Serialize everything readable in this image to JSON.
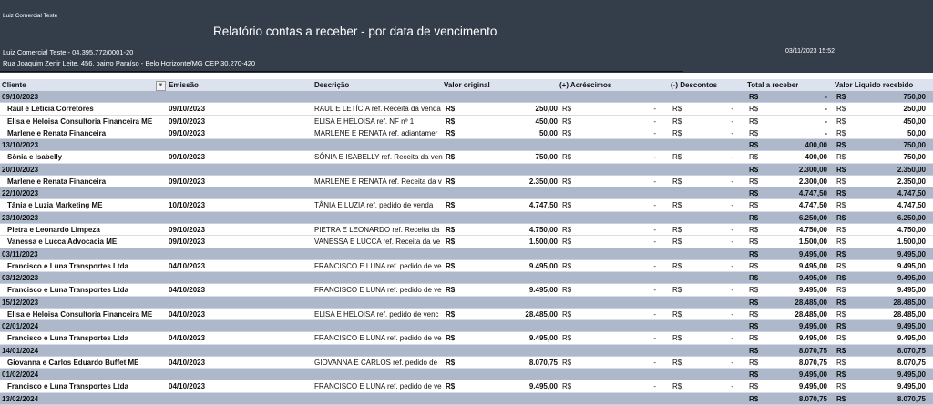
{
  "header": {
    "small_title": "Luiz Comercial Teste",
    "title": "Relatório contas a receber - por data de vencimento",
    "company": "Luiz Comercial Teste - 04.395.772/0001-20",
    "address": "Rua Joaquim Zenir Leite, 456, bairro Paraíso - Belo Horizonte/MG CEP 30.270-420",
    "datetime": "03/11/2023  15:52"
  },
  "columns": [
    "Cliente",
    "Emissão",
    "Descrição",
    "Valor original",
    "(+) Acréscimos",
    "(-) Descontos",
    "Total a receber",
    "Valor Liquido recebido"
  ],
  "currency": "R$",
  "dash": "-",
  "colors": {
    "header_bg": "#343e4b",
    "group_bg": "#adb9ca",
    "column_header_bg": "#dce3ef"
  },
  "groups": [
    {
      "date": "09/10/2023",
      "total": "-",
      "liquido": "750,00",
      "items": [
        {
          "cliente": "Raul e Letícia Corretores",
          "emissao": "09/10/2023",
          "descricao": "RAUL E LETÍCIA ref. Receita da venda",
          "valor": "250,00",
          "total": "-",
          "liquido": "250,00"
        },
        {
          "cliente": "Elisa e Heloisa Consultoria Financeira ME",
          "emissao": "09/10/2023",
          "descricao": "ELISA E HELOISA ref. NF nº 1",
          "valor": "450,00",
          "total": "-",
          "liquido": "450,00"
        },
        {
          "cliente": "Marlene e Renata Financeira",
          "emissao": "09/10/2023",
          "descricao": "MARLENE E RENATA ref. adiantamer",
          "valor": "50,00",
          "total": "-",
          "liquido": "50,00"
        }
      ]
    },
    {
      "date": "13/10/2023",
      "total": "400,00",
      "liquido": "750,00",
      "items": [
        {
          "cliente": "Sônia e Isabelly",
          "emissao": "09/10/2023",
          "descricao": "SÔNIA E ISABELLY ref. Receita da ven",
          "valor": "750,00",
          "total": "400,00",
          "liquido": "750,00"
        }
      ]
    },
    {
      "date": "20/10/2023",
      "total": "2.300,00",
      "liquido": "2.350,00",
      "items": [
        {
          "cliente": "Marlene e Renata Financeira",
          "emissao": "09/10/2023",
          "descricao": "MARLENE E RENATA ref. Receita da v",
          "valor": "2.350,00",
          "total": "2.300,00",
          "liquido": "2.350,00"
        }
      ]
    },
    {
      "date": "22/10/2023",
      "total": "4.747,50",
      "liquido": "4.747,50",
      "items": [
        {
          "cliente": "Tânia e Luzia Marketing ME",
          "emissao": "10/10/2023",
          "descricao": "TÂNIA E LUZIA ref. pedido de venda",
          "valor": "4.747,50",
          "total": "4.747,50",
          "liquido": "4.747,50"
        }
      ]
    },
    {
      "date": "23/10/2023",
      "total": "6.250,00",
      "liquido": "6.250,00",
      "items": [
        {
          "cliente": "Pietra e Leonardo Limpeza",
          "emissao": "09/10/2023",
          "descricao": "PIETRA E LEONARDO ref. Receita da",
          "valor": "4.750,00",
          "total": "4.750,00",
          "liquido": "4.750,00"
        },
        {
          "cliente": "Vanessa e Lucca Advocacia ME",
          "emissao": "09/10/2023",
          "descricao": "VANESSA E LUCCA ref. Receita da ve",
          "valor": "1.500,00",
          "total": "1.500,00",
          "liquido": "1.500,00"
        }
      ]
    },
    {
      "date": "03/11/2023",
      "total": "9.495,00",
      "liquido": "9.495,00",
      "items": [
        {
          "cliente": "Francisco e Luna Transportes Ltda",
          "emissao": "04/10/2023",
          "descricao": "FRANCISCO E LUNA ref. pedido de ve",
          "valor": "9.495,00",
          "total": "9.495,00",
          "liquido": "9.495,00"
        }
      ]
    },
    {
      "date": "03/12/2023",
      "total": "9.495,00",
      "liquido": "9.495,00",
      "items": [
        {
          "cliente": "Francisco e Luna Transportes Ltda",
          "emissao": "04/10/2023",
          "descricao": "FRANCISCO E LUNA ref. pedido de ve",
          "valor": "9.495,00",
          "total": "9.495,00",
          "liquido": "9.495,00"
        }
      ]
    },
    {
      "date": "15/12/2023",
      "total": "28.485,00",
      "liquido": "28.485,00",
      "items": [
        {
          "cliente": "Elisa e Heloisa Consultoria Financeira ME",
          "emissao": "04/10/2023",
          "descricao": "ELISA E HELOISA ref. pedido de venc",
          "valor": "28.485,00",
          "total": "28.485,00",
          "liquido": "28.485,00"
        }
      ]
    },
    {
      "date": "02/01/2024",
      "total": "9.495,00",
      "liquido": "9.495,00",
      "items": [
        {
          "cliente": "Francisco e Luna Transportes Ltda",
          "emissao": "04/10/2023",
          "descricao": "FRANCISCO E LUNA ref. pedido de ve",
          "valor": "9.495,00",
          "total": "9.495,00",
          "liquido": "9.495,00"
        }
      ]
    },
    {
      "date": "14/01/2024",
      "total": "8.070,75",
      "liquido": "8.070,75",
      "items": [
        {
          "cliente": "Giovanna e Carlos Eduardo Buffet ME",
          "emissao": "04/10/2023",
          "descricao": "GIOVANNA E CARLOS ref. pedido de",
          "valor": "8.070,75",
          "total": "8.070,75",
          "liquido": "8.070,75"
        }
      ]
    },
    {
      "date": "01/02/2024",
      "total": "9.495,00",
      "liquido": "9.495,00",
      "items": [
        {
          "cliente": "Francisco e Luna Transportes Ltda",
          "emissao": "04/10/2023",
          "descricao": "FRANCISCO E LUNA ref. pedido de ve",
          "valor": "9.495,00",
          "total": "9.495,00",
          "liquido": "9.495,00"
        }
      ]
    },
    {
      "date": "13/02/2024",
      "total": "8.070,75",
      "liquido": "8.070,75",
      "items": []
    }
  ]
}
